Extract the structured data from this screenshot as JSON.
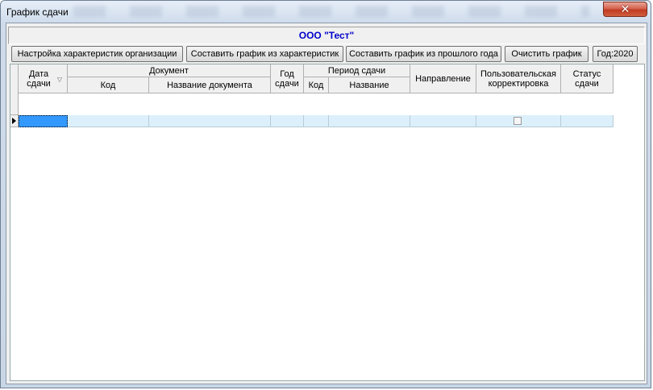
{
  "window": {
    "title": "График сдачи"
  },
  "org": {
    "name": "ООО \"Тест\""
  },
  "toolbar": {
    "btn_settings": "Настройка характеристик организации",
    "btn_from_chars": "Составить график из характеристик",
    "btn_from_prev": "Составить график из прошлого года",
    "btn_clear": "Очистить график",
    "btn_year": "Год:2020"
  },
  "grid": {
    "headers": {
      "date": "Дата сдачи",
      "document": "Документ",
      "doc_code": "Код",
      "doc_name": "Название документа",
      "year": "Год сдачи",
      "period": "Период сдачи",
      "period_code": "Код",
      "period_name": "Название",
      "direction": "Направление",
      "user_correction": "Пользовательская корректировка",
      "status": "Статус сдачи"
    },
    "rows": [
      {
        "date": "",
        "doc_code": "",
        "doc_name": "",
        "year": "",
        "period_code": "",
        "period_name": "",
        "direction": "",
        "user_correction": false,
        "status": ""
      }
    ]
  }
}
